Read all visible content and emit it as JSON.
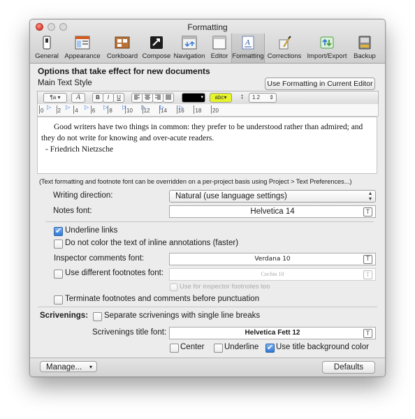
{
  "window": {
    "title": "Formatting"
  },
  "toolbar": {
    "items": [
      {
        "label": "General",
        "icon": "general-icon"
      },
      {
        "label": "Appearance",
        "icon": "appearance-icon"
      },
      {
        "label": "Corkboard",
        "icon": "corkboard-icon"
      },
      {
        "label": "Compose",
        "icon": "compose-icon"
      },
      {
        "label": "Navigation",
        "icon": "navigation-icon"
      },
      {
        "label": "Editor",
        "icon": "editor-icon"
      },
      {
        "label": "Formatting",
        "icon": "formatting-icon",
        "selected": true
      },
      {
        "label": "Corrections",
        "icon": "corrections-icon"
      },
      {
        "label": "Import/Export",
        "icon": "import-export-icon"
      },
      {
        "label": "Backup",
        "icon": "backup-icon"
      }
    ]
  },
  "section": {
    "heading": "Options that take effect for new documents",
    "main_text_style": "Main Text Style",
    "use_formatting_button": "Use Formatting in Current Editor"
  },
  "format_bar": {
    "style_menu": "¶a",
    "font_button": "A",
    "bold": "B",
    "italic": "I",
    "underline": "U",
    "highlight_label": "abc",
    "line_spacing_icon": "↕",
    "line_spacing_value": "1.2",
    "text_color": "#000000",
    "highlight_color": "#e6f52a"
  },
  "ruler": {
    "numbers": [
      "0",
      "2",
      "4",
      "6",
      "8",
      "10",
      "12",
      "14",
      "16",
      "18",
      "20"
    ]
  },
  "editor": {
    "line1": "Good writers have two things in common: they prefer to be understood rather than admired; and",
    "line2": "they do not write for knowing and over-acute readers.",
    "line3": "- Friedrich Nietzsche"
  },
  "override_note": "(Text formatting and footnote font can be overridden on a per-project basis using Project > Text Preferences...)",
  "writing_direction": {
    "label": "Writing direction:",
    "value": "Natural (use language settings)"
  },
  "notes_font": {
    "label": "Notes font:",
    "value": "Helvetica 14"
  },
  "underline_links": {
    "label": "Underline links",
    "checked": true
  },
  "no_color_inline": {
    "label": "Do not color the text of inline annotations (faster)",
    "checked": false
  },
  "inspector_comments_font": {
    "label": "Inspector comments font:",
    "value": "Verdana 10"
  },
  "different_footnotes": {
    "label": "Use different footnotes font:",
    "value": "Cochin 10",
    "checked": false
  },
  "inspector_footnotes_too": {
    "label": "Use for inspector footnotes too",
    "checked": false
  },
  "terminate_footnotes": {
    "label": "Terminate footnotes and comments before punctuation",
    "checked": false
  },
  "scrivenings": {
    "label": "Scrivenings:",
    "separate": {
      "label": "Separate scrivenings with single line breaks",
      "checked": false
    },
    "title_font_label": "Scrivenings title font:",
    "title_font_value": "Helvetica Fett 12",
    "center": {
      "label": "Center",
      "checked": false
    },
    "underline": {
      "label": "Underline",
      "checked": false
    },
    "title_background": {
      "label": "Use title background  color",
      "checked": true
    }
  },
  "bottom": {
    "manage": "Manage...",
    "defaults": "Defaults"
  },
  "colors": {
    "accent": "#2f79d8",
    "close": "#e2463a"
  }
}
